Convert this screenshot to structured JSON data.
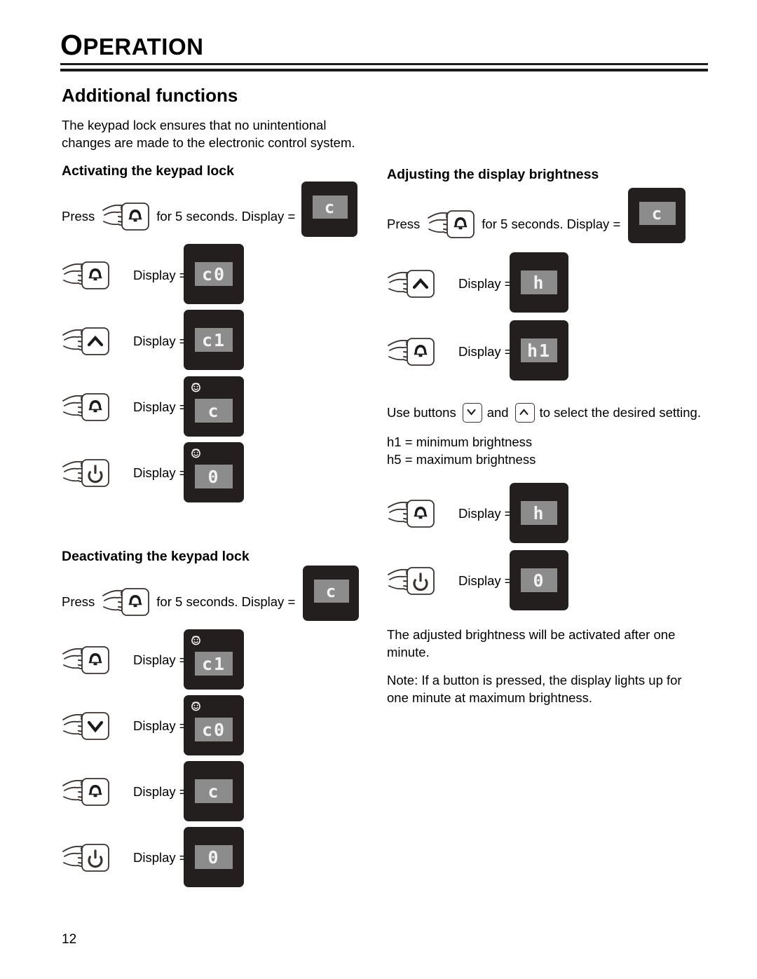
{
  "header": {
    "chapter_title": "OPERATION",
    "chapter_title_first": "O",
    "chapter_title_rest": "PERATION"
  },
  "page_number": "12",
  "section": {
    "title": "Additional functions",
    "intro": "The keypad lock ensures that no unintentional\nchanges are made to the electronic control system."
  },
  "left_column": {
    "activating": {
      "heading": "Activating the keypad lock",
      "press_prefix": "Press",
      "press_suffix": "for 5 seconds. Display =",
      "press_key_icon": "bell-icon",
      "press_display": {
        "value": "c",
        "smiley": false,
        "wide": true
      },
      "steps": [
        {
          "key_icon": "bell-icon",
          "label": "Display =",
          "value": "c0",
          "smiley": false
        },
        {
          "key_icon": "chevron-up-icon",
          "label": "Display =",
          "value": "c1",
          "smiley": false
        },
        {
          "key_icon": "bell-icon",
          "label": "Display =",
          "value": "c",
          "smiley": true
        },
        {
          "key_icon": "power-icon",
          "label": "Display =",
          "value": "0",
          "smiley": true
        }
      ]
    },
    "deactivating": {
      "heading": "Deactivating the keypad lock",
      "press_prefix": "Press",
      "press_suffix": "for 5 seconds. Display =",
      "press_key_icon": "bell-icon",
      "press_display": {
        "value": "c",
        "smiley": false,
        "wide": true
      },
      "steps": [
        {
          "key_icon": "bell-icon",
          "label": "Display =",
          "value": "c1",
          "smiley": true
        },
        {
          "key_icon": "chevron-down-icon",
          "label": "Display =",
          "value": "c0",
          "smiley": true
        },
        {
          "key_icon": "bell-icon",
          "label": "Display =",
          "value": "c",
          "smiley": false
        },
        {
          "key_icon": "power-icon",
          "label": "Display =",
          "value": "0",
          "smiley": false
        }
      ]
    }
  },
  "right_column": {
    "brightness": {
      "heading": "Adjusting the display brightness",
      "press_prefix": "Press",
      "press_suffix": "for 5 seconds. Display =",
      "press_key_icon": "bell-icon",
      "press_display": {
        "value": "c",
        "smiley": false,
        "wide": true
      },
      "steps_top": [
        {
          "key_icon": "chevron-up-icon",
          "label": "Display =",
          "value": "h",
          "smiley": false
        },
        {
          "key_icon": "bell-icon",
          "label": "Display =",
          "value": "h1",
          "smiley": false
        }
      ],
      "use_buttons": {
        "prefix": "Use buttons",
        "middle": "and",
        "suffix": "to select the desired setting.",
        "first_key_icon": "chevron-down-icon",
        "second_key_icon": "chevron-up-icon"
      },
      "legend": "h1 = minimum brightness\nh5 = maximum brightness",
      "steps_bottom": [
        {
          "key_icon": "bell-icon",
          "label": "Display =",
          "value": "h",
          "smiley": false
        },
        {
          "key_icon": "power-icon",
          "label": "Display =",
          "value": "0",
          "smiley": false
        }
      ],
      "note_1": "The adjusted brightness will be activated after one\nminute.",
      "note_2": "Note: If a button is pressed, the display lights up for\none minute at maximum brightness."
    }
  },
  "colors": {
    "panel_bg": "#231f1e",
    "lcd_bg": "#8c8c8c",
    "segment": "#f2f2f2",
    "rule": "#1a1a1a",
    "key_outline": "#3a3230"
  }
}
